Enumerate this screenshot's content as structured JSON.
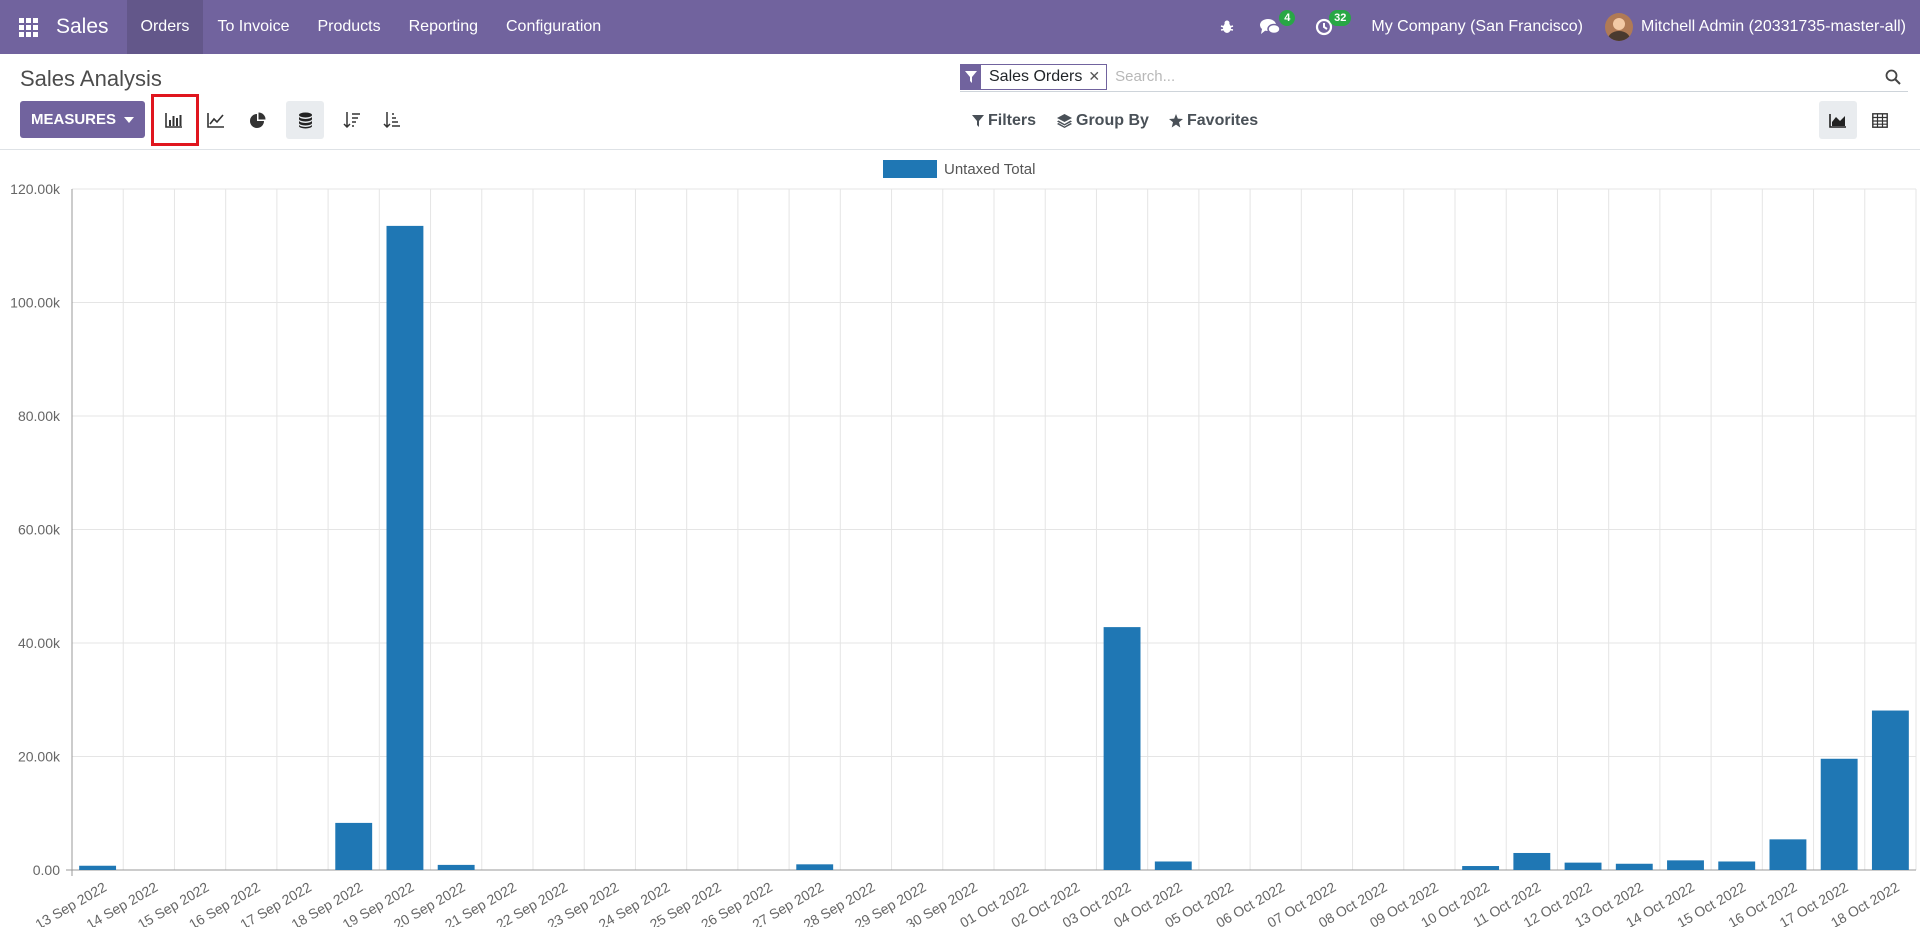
{
  "navbar": {
    "app_name": "Sales",
    "menu": [
      {
        "label": "Orders",
        "active": true
      },
      {
        "label": "To Invoice",
        "active": false
      },
      {
        "label": "Products",
        "active": false
      },
      {
        "label": "Reporting",
        "active": false
      },
      {
        "label": "Configuration",
        "active": false
      }
    ],
    "messages_count": "4",
    "activities_count": "32",
    "company": "My Company (San Francisco)",
    "user": "Mitchell Admin (20331735-master-all)"
  },
  "control_panel": {
    "title": "Sales Analysis",
    "search": {
      "facet_label": "Sales Orders",
      "placeholder": "Search...",
      "value": ""
    },
    "measures_label": "MEASURES",
    "chart_types": [
      "bar-chart-icon",
      "line-chart-icon",
      "pie-chart-icon"
    ],
    "filters_label": "Filters",
    "group_by_label": "Group By",
    "favorites_label": "Favorites"
  },
  "colors": {
    "navbar": "#71639e",
    "bar": "#1f77b4",
    "highlight": "#e0161e",
    "badge": "#28a745"
  },
  "chart_data": {
    "type": "bar",
    "legend": "Untaxed Total",
    "legend_position": "top-center",
    "grid": true,
    "ylim": [
      0,
      120000
    ],
    "yticks": [
      "0.00",
      "20.00k",
      "40.00k",
      "60.00k",
      "80.00k",
      "100.00k",
      "120.00k"
    ],
    "categories": [
      "13 Sep 2022",
      "14 Sep 2022",
      "15 Sep 2022",
      "16 Sep 2022",
      "17 Sep 2022",
      "18 Sep 2022",
      "19 Sep 2022",
      "20 Sep 2022",
      "21 Sep 2022",
      "22 Sep 2022",
      "23 Sep 2022",
      "24 Sep 2022",
      "25 Sep 2022",
      "26 Sep 2022",
      "27 Sep 2022",
      "28 Sep 2022",
      "29 Sep 2022",
      "30 Sep 2022",
      "01 Oct 2022",
      "02 Oct 2022",
      "03 Oct 2022",
      "04 Oct 2022",
      "05 Oct 2022",
      "06 Oct 2022",
      "07 Oct 2022",
      "08 Oct 2022",
      "09 Oct 2022",
      "10 Oct 2022",
      "11 Oct 2022",
      "12 Oct 2022",
      "13 Oct 2022",
      "14 Oct 2022",
      "15 Oct 2022",
      "16 Oct 2022",
      "17 Oct 2022",
      "18 Oct 2022"
    ],
    "series": [
      {
        "name": "Untaxed Total",
        "values": [
          750,
          0,
          0,
          0,
          0,
          8300,
          113500,
          900,
          0,
          0,
          0,
          0,
          0,
          0,
          1000,
          0,
          0,
          0,
          0,
          0,
          42800,
          1500,
          0,
          0,
          0,
          0,
          0,
          700,
          3000,
          1300,
          1100,
          1700,
          1500,
          5400,
          19600,
          28100
        ]
      }
    ]
  }
}
